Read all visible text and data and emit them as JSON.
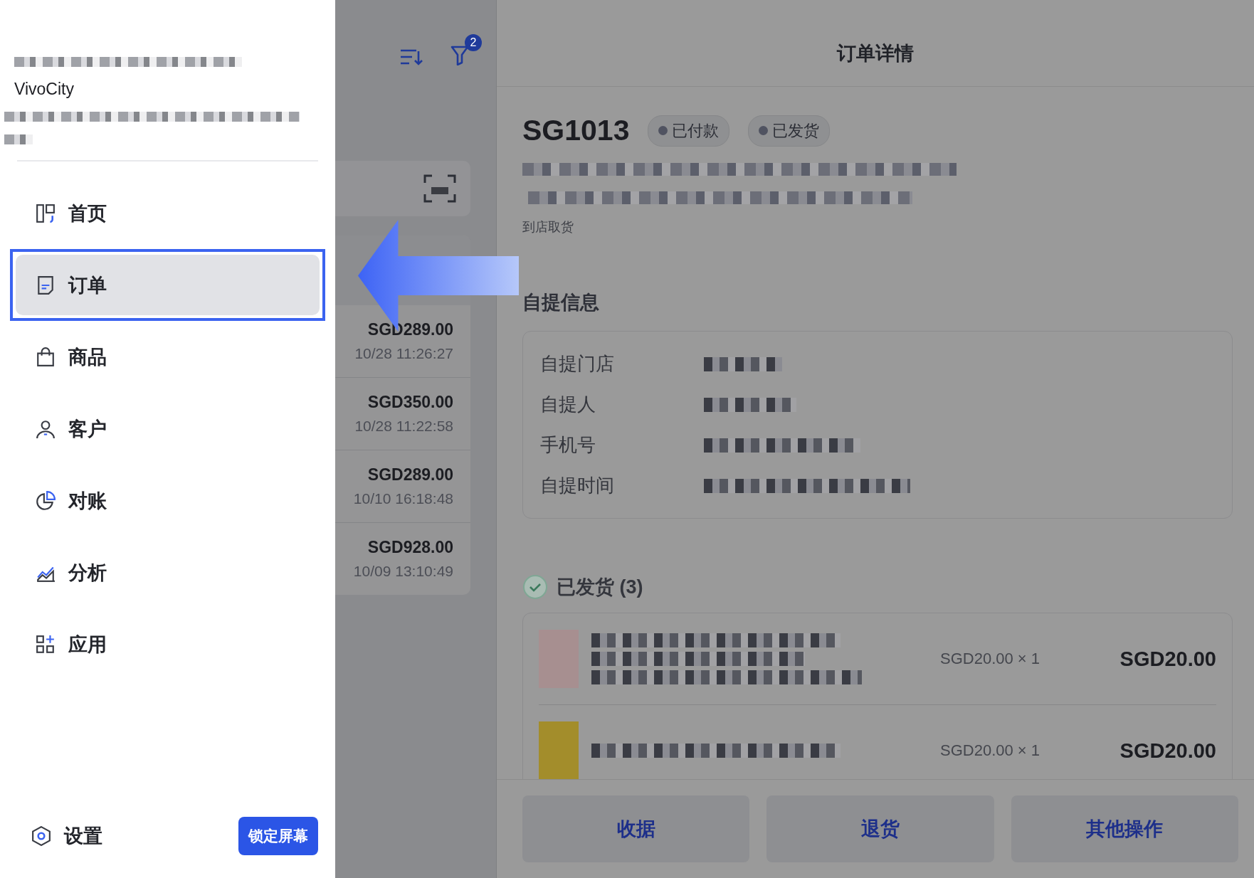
{
  "sidebar": {
    "store_name": "VivoCity",
    "nav_items": [
      {
        "label": "首页",
        "selected": false
      },
      {
        "label": "订单",
        "selected": true
      },
      {
        "label": "商品",
        "selected": false
      },
      {
        "label": "客户",
        "selected": false
      },
      {
        "label": "对账",
        "selected": false
      },
      {
        "label": "分析",
        "selected": false
      },
      {
        "label": "应用",
        "selected": false
      }
    ],
    "settings_label": "设置",
    "lock_button": "锁定屏幕"
  },
  "order_list": {
    "filter_count": "2",
    "orders": [
      {
        "amount": "SGD289.00",
        "time": "10/28 11:26:27"
      },
      {
        "amount": "SGD350.00",
        "time": "10/28 11:22:58"
      },
      {
        "amount": "SGD289.00",
        "time": "10/10 16:18:48"
      },
      {
        "amount": "SGD928.00",
        "time": "10/09 13:10:49"
      }
    ]
  },
  "detail": {
    "title": "订单详情",
    "order_number": "SG1013",
    "badges": [
      "已付款",
      "已发货"
    ],
    "delivery_method": "到店取货",
    "pickup_section": {
      "title": "自提信息",
      "fields": [
        "自提门店",
        "自提人",
        "手机号",
        "自提时间"
      ]
    },
    "shipped_section": {
      "title": "已发货 (3)",
      "items": [
        {
          "unit_price": "SGD20.00 × 1",
          "total": "SGD20.00"
        },
        {
          "unit_price": "SGD20.00 × 1",
          "total": "SGD20.00"
        }
      ]
    }
  },
  "actions": [
    "收据",
    "退货",
    "其他操作"
  ]
}
